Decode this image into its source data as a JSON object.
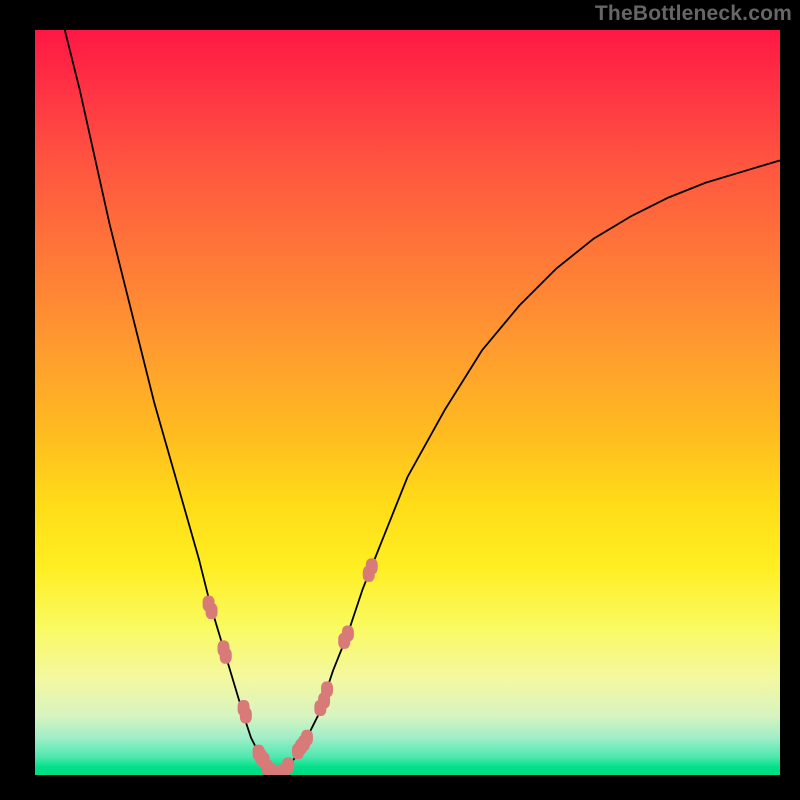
{
  "watermark_text": "TheBottleneck.com",
  "colors": {
    "page_bg": "#000000",
    "watermark": "#666666",
    "curve_stroke": "#000000",
    "marker_fill": "#d87b78",
    "marker_stroke": "#d87b78",
    "gradient_top": "#ff1744",
    "gradient_bottom": "#00dd80"
  },
  "chart_data": {
    "type": "line",
    "title": "",
    "xlabel": "",
    "ylabel": "",
    "xlim": [
      0,
      100
    ],
    "ylim": [
      0,
      100
    ],
    "series": [
      {
        "name": "curve",
        "x": [
          4,
          6,
          8,
          10,
          12,
          14,
          16,
          18,
          20,
          22,
          23.5,
          25,
          26.5,
          28,
          29,
          30,
          31,
          32,
          33,
          34,
          36,
          38,
          40,
          42,
          44,
          46,
          50,
          55,
          60,
          65,
          70,
          75,
          80,
          85,
          90,
          95,
          100
        ],
        "y": [
          100,
          92,
          83,
          74,
          66,
          58,
          50,
          43,
          36,
          29,
          23,
          18,
          13,
          8,
          5,
          3,
          1,
          0,
          0,
          1,
          4,
          8,
          14,
          19,
          25,
          30,
          40,
          49,
          57,
          63,
          68,
          72,
          75,
          77.5,
          79.5,
          81,
          82.5
        ]
      }
    ],
    "marker_points": [
      {
        "x": 23.3,
        "y": 23
      },
      {
        "x": 23.7,
        "y": 22
      },
      {
        "x": 25.3,
        "y": 17
      },
      {
        "x": 25.6,
        "y": 16
      },
      {
        "x": 28.0,
        "y": 9
      },
      {
        "x": 28.3,
        "y": 8
      },
      {
        "x": 30.0,
        "y": 3.0
      },
      {
        "x": 30.3,
        "y": 2.5
      },
      {
        "x": 30.7,
        "y": 2.0
      },
      {
        "x": 31.2,
        "y": 1.0
      },
      {
        "x": 31.7,
        "y": 0.5
      },
      {
        "x": 32.3,
        "y": 0.2
      },
      {
        "x": 32.8,
        "y": 0.2
      },
      {
        "x": 33.4,
        "y": 0.5
      },
      {
        "x": 34.0,
        "y": 1.3
      },
      {
        "x": 35.3,
        "y": 3.2
      },
      {
        "x": 35.7,
        "y": 3.8
      },
      {
        "x": 36.1,
        "y": 4.3
      },
      {
        "x": 36.5,
        "y": 5.0
      },
      {
        "x": 38.3,
        "y": 9
      },
      {
        "x": 38.8,
        "y": 10
      },
      {
        "x": 39.2,
        "y": 11.5
      },
      {
        "x": 41.5,
        "y": 18
      },
      {
        "x": 42.0,
        "y": 19
      },
      {
        "x": 44.8,
        "y": 27
      },
      {
        "x": 45.2,
        "y": 28
      }
    ]
  }
}
